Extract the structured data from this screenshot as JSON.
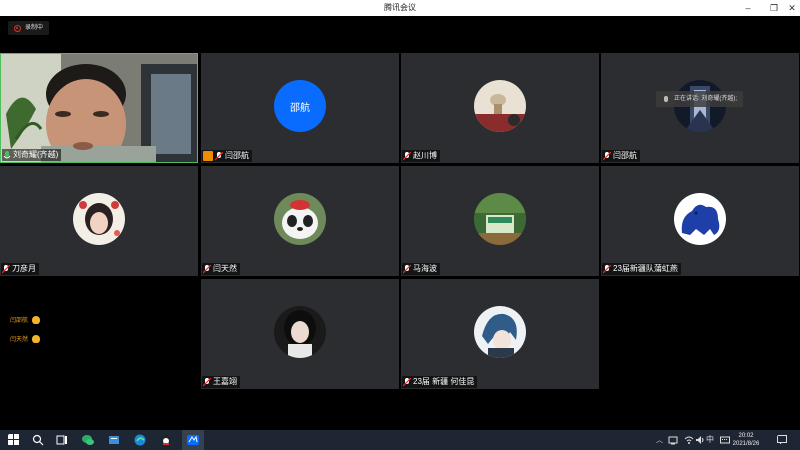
{
  "window": {
    "title": "腾讯会议",
    "minimize": "–",
    "restore": "❐",
    "close": "✕"
  },
  "recording": {
    "label": "录制中"
  },
  "speaking": {
    "label": "正在讲话: 刘奇耀(齐越);"
  },
  "participants": [
    {
      "name": "刘奇耀(齐越)",
      "avatar": "video",
      "mic": "active"
    },
    {
      "name": "闫邵航",
      "avatar": "text",
      "avatar_text": "邵航",
      "mic": "muted",
      "host": true
    },
    {
      "name": "赵川博",
      "avatar": "image",
      "mic": "muted"
    },
    {
      "name": "闫邵航",
      "avatar": "image",
      "mic": "muted"
    },
    {
      "name": "刀彦月",
      "avatar": "image",
      "mic": "muted"
    },
    {
      "name": "闫天然",
      "avatar": "image",
      "mic": "muted"
    },
    {
      "name": "马海波",
      "avatar": "image",
      "mic": "muted"
    },
    {
      "name": "23届新疆队蒲虹燕",
      "avatar": "image",
      "mic": "muted"
    },
    {
      "name": "王嘉翊",
      "avatar": "image",
      "mic": "muted"
    },
    {
      "name": "23届 新疆 何佳昆",
      "avatar": "image",
      "mic": "muted"
    }
  ],
  "reactions": [
    {
      "name": "闫邵航",
      "icon": "clap-icon"
    },
    {
      "name": "闫天然",
      "icon": "clap-icon"
    }
  ],
  "taskbar": {
    "time": "20:02",
    "date": "2021/8/26",
    "ime": "中",
    "tray_icons": [
      "chevron-up-icon",
      "network-icon",
      "volume-icon",
      "ime-icon"
    ]
  },
  "colors": {
    "accent": "#0a6cff",
    "active_border": "#4cbf5b",
    "tile_bg": "#2b2d31",
    "host_badge": "#f08c00"
  }
}
